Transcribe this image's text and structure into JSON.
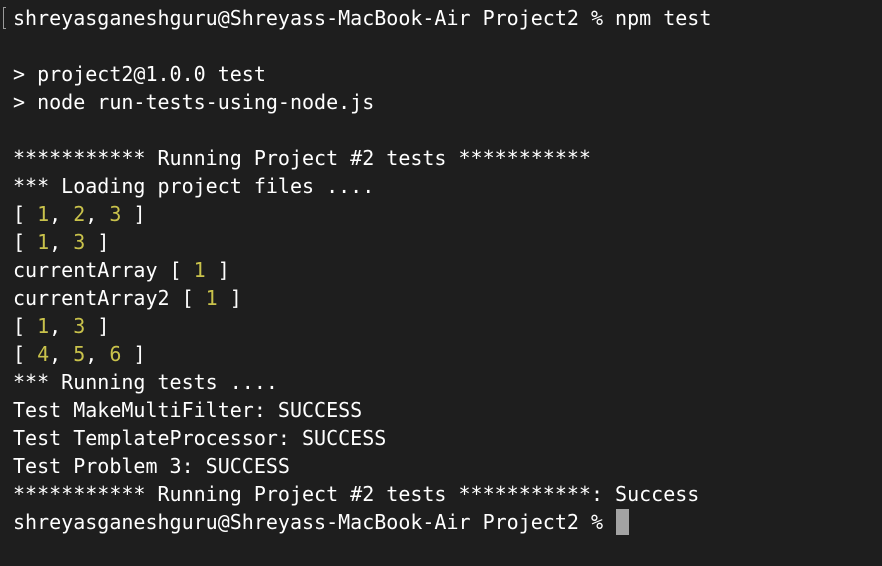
{
  "colors": {
    "background": "#1e1e1e",
    "text": "#ffffff",
    "number": "#c9c24b",
    "cursor": "#a3a3a3"
  },
  "terminal": {
    "prompt_command": "shreyasganeshguru@Shreyass-MacBook-Air Project2 % npm test",
    "npm_header": "> project2@1.0.0 test",
    "npm_command": "> node run-tests-using-node.js",
    "running_header": "*********** Running Project #2 tests ***********",
    "loading": "*** Loading project files ....",
    "arrays": {
      "arr1": {
        "open": "[ ",
        "n1": "1",
        "sep1": ", ",
        "n2": "2",
        "sep2": ", ",
        "n3": "3",
        "close": " ]"
      },
      "arr2": {
        "open": "[ ",
        "n1": "1",
        "sep1": ", ",
        "n2": "3",
        "close": " ]"
      },
      "current1": {
        "label": "currentArray [ ",
        "n1": "1",
        "close": " ]"
      },
      "current2": {
        "label": "currentArray2 [ ",
        "n1": "1",
        "close": " ]"
      },
      "arr3": {
        "open": "[ ",
        "n1": "1",
        "sep1": ", ",
        "n2": "3",
        "close": " ]"
      },
      "arr4": {
        "open": "[ ",
        "n1": "4",
        "sep1": ", ",
        "n2": "5",
        "sep2": ", ",
        "n3": "6",
        "close": " ]"
      }
    },
    "running_tests": "*** Running tests ....",
    "test1": "Test MakeMultiFilter: SUCCESS",
    "test2": "Test TemplateProcessor: SUCCESS",
    "test3": "Test Problem 3: SUCCESS",
    "running_footer": "*********** Running Project #2 tests ***********: Success",
    "final_prompt": "shreyasganeshguru@Shreyass-MacBook-Air Project2 % "
  }
}
